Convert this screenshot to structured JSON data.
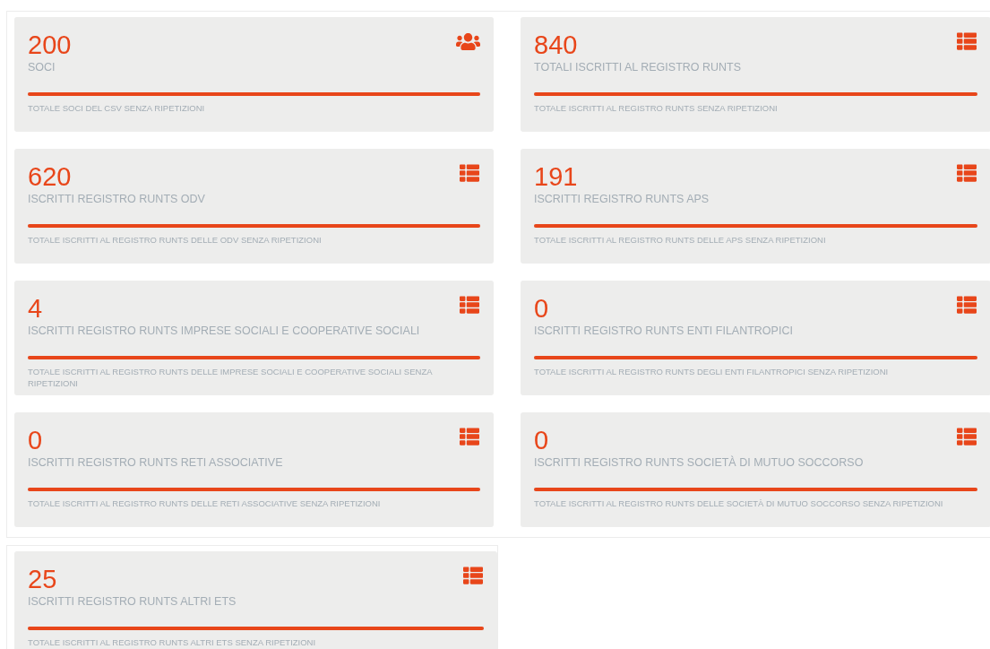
{
  "panels": [
    {
      "cards": [
        {
          "value": "200",
          "label": "SOCI",
          "description": "TOTALE SOCI DEL CSV SENZA RIPETIZIONI",
          "kind": "users",
          "level": 1
        },
        {
          "value": "840",
          "label": "TOTALI ISCRITTI AL REGISTRO RUNTS",
          "description": "TOTALE ISCRITTI AL REGISTRO RUNTS SENZA RIPETIZIONI",
          "kind": "list",
          "level": 1
        },
        {
          "value": "620",
          "label": "ISCRITTI REGISTRO RUNTS ODV",
          "description": "TOTALE ISCRITTI AL REGISTRO RUNTS DELLE ODV SENZA RIPETIZIONI",
          "kind": "list",
          "level": 1
        },
        {
          "value": "191",
          "label": "ISCRITTI REGISTRO RUNTS APS",
          "description": "TOTALE ISCRITTI AL REGISTRO RUNTS DELLE APS SENZA RIPETIZIONI",
          "kind": "list",
          "level": 1
        },
        {
          "value": "4",
          "label": "ISCRITTI REGISTRO RUNTS IMPRESE SOCIALI E COOPERATIVE SOCIALI",
          "description": "TOTALE ISCRITTI AL REGISTRO RUNTS DELLE IMPRESE SOCIALI E COOPERATIVE SOCIALI SENZA RIPETIZIONI",
          "kind": "list",
          "level": 1
        },
        {
          "value": "0",
          "label": "ISCRITTI REGISTRO RUNTS ENTI FILANTROPICI",
          "description": "TOTALE ISCRITTI AL REGISTRO RUNTS DEGLI ENTI FILANTROPICI SENZA RIPETIZIONI",
          "kind": "list",
          "level": 1
        },
        {
          "value": "0",
          "label": "ISCRITTI REGISTRO RUNTS RETI ASSOCIATIVE",
          "description": "TOTALE ISCRITTI AL REGISTRO RUNTS DELLE RETI ASSOCIATIVE SENZA RIPETIZIONI",
          "kind": "list",
          "level": 1
        },
        {
          "value": "0",
          "label": "ISCRITTI REGISTRO RUNTS SOCIETÀ DI MUTUO SOCCORSO",
          "description": "TOTALE ISCRITTI AL REGISTRO RUNTS DELLE SOCIETÀ DI MUTUO SOCCORSO SENZA RIPETIZIONI",
          "kind": "list",
          "level": 1
        }
      ]
    },
    {
      "cards": [
        {
          "value": "25",
          "label": "ISCRITTI REGISTRO RUNTS ALTRI ETS",
          "description": "TOTALE ISCRITTI AL REGISTRO RUNTS ALTRI ETS SENZA RIPETIZIONI",
          "kind": "list",
          "level": 1
        }
      ]
    }
  ]
}
